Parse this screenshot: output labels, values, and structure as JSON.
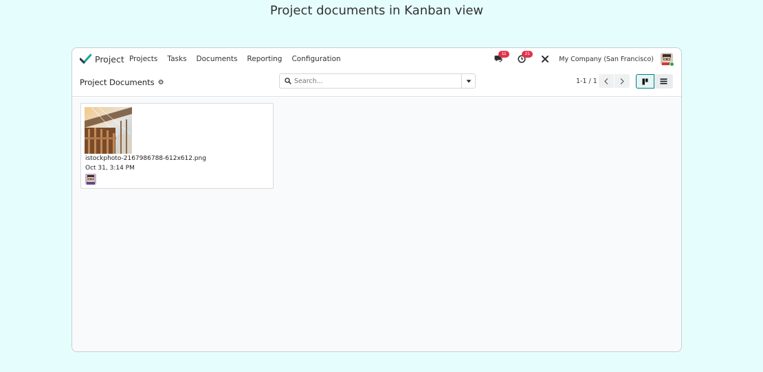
{
  "caption": "Project documents in Kanban view",
  "navbar": {
    "app_name": "Project",
    "menu": [
      "Projects",
      "Tasks",
      "Documents",
      "Reporting",
      "Configuration"
    ],
    "messages_count": "11",
    "activities_count": "21",
    "company": "My Company (San Francisco)"
  },
  "control": {
    "breadcrumb": "Project Documents",
    "search_placeholder": "Search...",
    "pager": "1-1 / 1"
  },
  "documents": [
    {
      "name": "istockphoto-2167986788-612x612.png",
      "date": "Oct 31, 3:14 PM"
    }
  ],
  "colors": {
    "accent": "#017e84",
    "badge": "#e0334b",
    "page_bg": "#e6fdfe"
  }
}
